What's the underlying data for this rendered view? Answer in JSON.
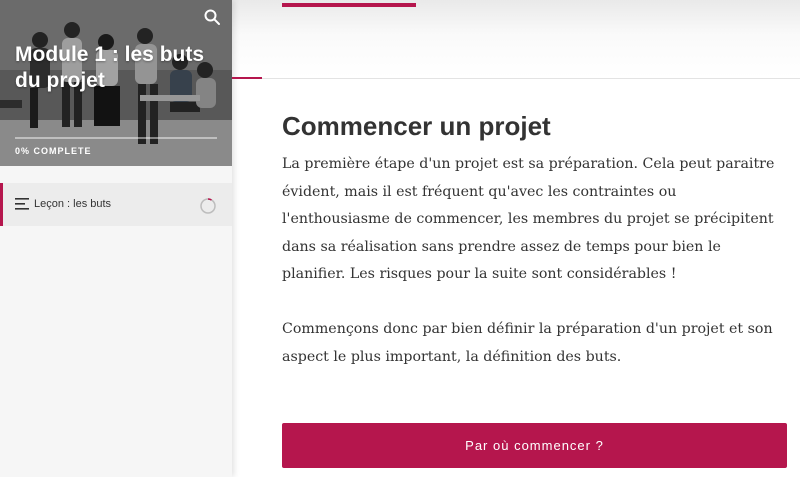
{
  "sidebar": {
    "course_title": "Module 1 : les buts du projet",
    "progress_label": "0% COMPLETE",
    "progress_fraction": 0,
    "lessons": [
      {
        "label": "Leçon : les buts",
        "status": "not-started"
      }
    ]
  },
  "lesson": {
    "heading": "Commencer un projet",
    "paragraphs": [
      "La première étape d'un projet est sa préparation. Cela peut paraitre évident, mais il est fréquent qu'avec les contraintes ou l'enthousiasme de commencer, les membres du projet se précipitent dans sa réalisation sans prendre assez de temps pour bien le planifier. Les risques pour la suite sont considérables !",
      "Commençons donc par bien définir la préparation d'un projet et son aspect le plus important, la définition des buts."
    ],
    "cta_label": "Par où commencer ?"
  },
  "colors": {
    "accent": "#b5164d",
    "text": "#333333",
    "sidebar_bg": "#f6f6f6"
  },
  "icons": {
    "search": "search-icon",
    "lesson": "lines-icon",
    "status": "progress-ring-icon"
  }
}
